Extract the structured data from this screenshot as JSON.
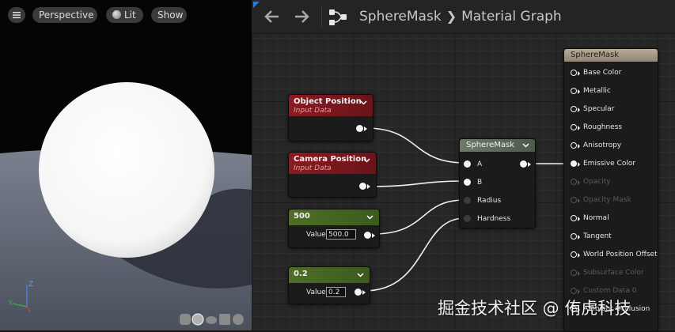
{
  "viewport": {
    "perspective_label": "Perspective",
    "lit_label": "Lit",
    "show_label": "Show"
  },
  "toolbar": {
    "breadcrumb_asset": "SphereMask",
    "breadcrumb_graph": "Material Graph"
  },
  "nodes": {
    "object_position": {
      "title": "Object Position",
      "subtitle": "Input Data"
    },
    "camera_position": {
      "title": "Camera Position",
      "subtitle": "Input Data"
    },
    "const_500": {
      "title": "500",
      "value_label": "Value",
      "value": "500.0"
    },
    "const_02": {
      "title": "0.2",
      "value_label": "Value",
      "value": "0.2"
    },
    "sphere_mask": {
      "title": "SphereMask",
      "inputs": [
        "A",
        "B",
        "Radius",
        "Hardness"
      ]
    },
    "result": {
      "title": "SphereMask",
      "pins": [
        "Base Color",
        "Metallic",
        "Specular",
        "Roughness",
        "Anisotropy",
        "Emissive Color",
        "Opacity",
        "Opacity Mask",
        "Normal",
        "Tangent",
        "World Position Offset",
        "Subsurface Color",
        "Custom Data 0",
        "Ambient Occlusion"
      ],
      "disabled_pins": [
        "Opacity",
        "Opacity Mask",
        "Subsurface Color",
        "Custom Data 0"
      ]
    }
  },
  "axis_labels": {
    "z": "Z",
    "x": "X"
  },
  "watermark": "掘金技术社区 @ 侑虎科技",
  "colors": {
    "accent": "#2f7ad1",
    "node_red": "#8c1a22",
    "node_green": "#4e6e26"
  }
}
